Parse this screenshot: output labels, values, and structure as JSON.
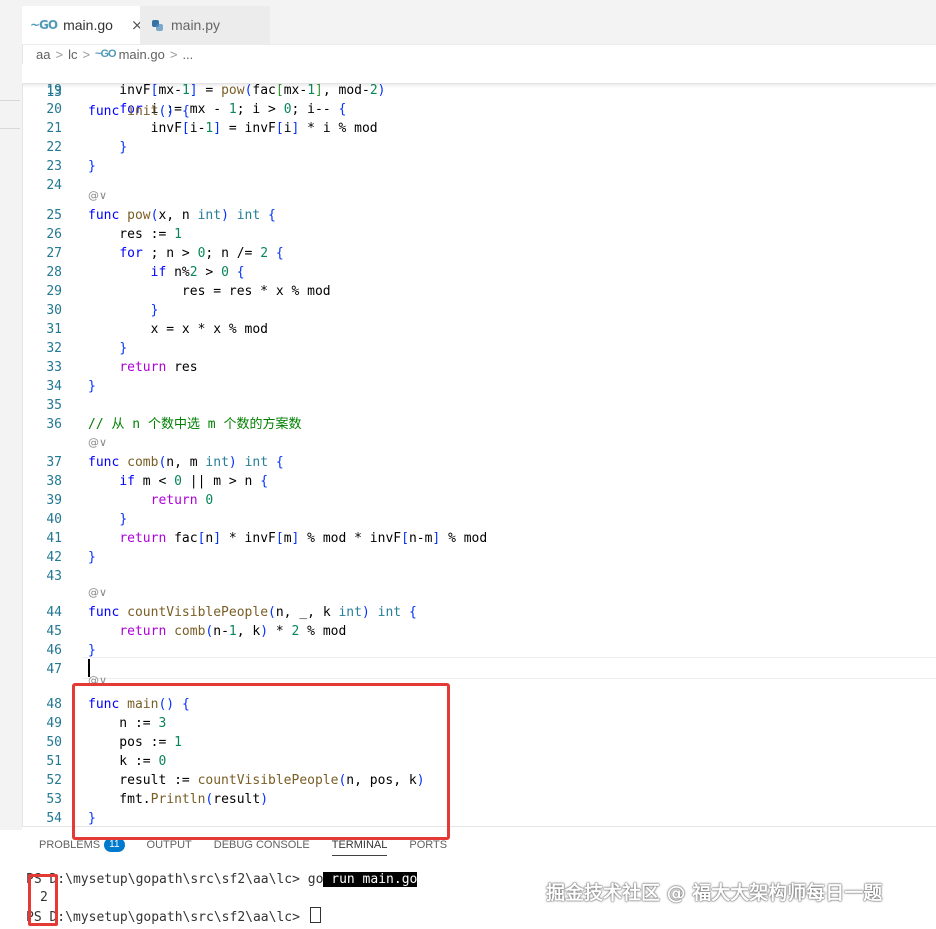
{
  "tabs": [
    {
      "icon": "go-icon",
      "label": "main.go",
      "active": true,
      "close": "×"
    },
    {
      "icon": "python-icon",
      "label": "main.py",
      "active": false
    }
  ],
  "breadcrumb": {
    "parts": [
      "aa",
      "lc",
      "main.go",
      "..."
    ],
    "separator": ">"
  },
  "editor": {
    "sticky": {
      "ln": "13",
      "text": "func init() {"
    },
    "codelens_glyph": "@∨",
    "lines": [
      {
        "ln": "19",
        "text": "    invF[mx-1] = pow(fac[mx-1], mod-2)"
      },
      {
        "ln": "20",
        "text": "    for i := mx - 1; i > 0; i-- {"
      },
      {
        "ln": "21",
        "text": "        invF[i-1] = invF[i] * i % mod"
      },
      {
        "ln": "22",
        "text": "    }"
      },
      {
        "ln": "23",
        "text": "}"
      },
      {
        "ln": "24",
        "text": ""
      },
      {
        "ln": "25",
        "text": "func pow(x, n int) int {"
      },
      {
        "ln": "26",
        "text": "    res := 1"
      },
      {
        "ln": "27",
        "text": "    for ; n > 0; n /= 2 {"
      },
      {
        "ln": "28",
        "text": "        if n%2 > 0 {"
      },
      {
        "ln": "29",
        "text": "            res = res * x % mod"
      },
      {
        "ln": "30",
        "text": "        }"
      },
      {
        "ln": "31",
        "text": "        x = x * x % mod"
      },
      {
        "ln": "32",
        "text": "    }"
      },
      {
        "ln": "33",
        "text": "    return res"
      },
      {
        "ln": "34",
        "text": "}"
      },
      {
        "ln": "35",
        "text": ""
      },
      {
        "ln": "36",
        "text": "// 从 n 个数中选 m 个数的方案数"
      },
      {
        "ln": "37",
        "text": "func comb(n, m int) int {"
      },
      {
        "ln": "38",
        "text": "    if m < 0 || m > n {"
      },
      {
        "ln": "39",
        "text": "        return 0"
      },
      {
        "ln": "40",
        "text": "    }"
      },
      {
        "ln": "41",
        "text": "    return fac[n] * invF[m] % mod * invF[n-m] % mod"
      },
      {
        "ln": "42",
        "text": "}"
      },
      {
        "ln": "43",
        "text": ""
      },
      {
        "ln": "44",
        "text": "func countVisiblePeople(n, _, k int) int {"
      },
      {
        "ln": "45",
        "text": "    return comb(n-1, k) * 2 % mod"
      },
      {
        "ln": "46",
        "text": "}"
      },
      {
        "ln": "47",
        "text": ""
      },
      {
        "ln": "48",
        "text": "func main() {"
      },
      {
        "ln": "49",
        "text": "    n := 3"
      },
      {
        "ln": "50",
        "text": "    pos := 1"
      },
      {
        "ln": "51",
        "text": "    k := 0"
      },
      {
        "ln": "52",
        "text": "    result := countVisiblePeople(n, pos, k)"
      },
      {
        "ln": "53",
        "text": "    fmt.Println(result)"
      },
      {
        "ln": "54",
        "text": "}"
      }
    ]
  },
  "panel": {
    "tabs": [
      {
        "label": "PROBLEMS",
        "badge": "11"
      },
      {
        "label": "OUTPUT"
      },
      {
        "label": "DEBUG CONSOLE"
      },
      {
        "label": "TERMINAL",
        "active": true
      },
      {
        "label": "PORTS"
      }
    ],
    "terminal": {
      "prompt1": "PS D:\\mysetup\\gopath\\src\\sf2\\aa\\lc> ",
      "cmd_go": "go",
      "cmd_rest": " run main.go",
      "output": "2",
      "prompt2": "PS D:\\mysetup\\gopath\\src\\sf2\\aa\\lc> "
    }
  },
  "watermark": "掘金技术社区 @ 福大大架构师每日一题",
  "colors": {
    "highlight": "#e53935",
    "line_number": "#237893",
    "keyword": "#0000ff",
    "function": "#795e26",
    "type": "#267f99",
    "number": "#098658",
    "comment": "#008000"
  }
}
